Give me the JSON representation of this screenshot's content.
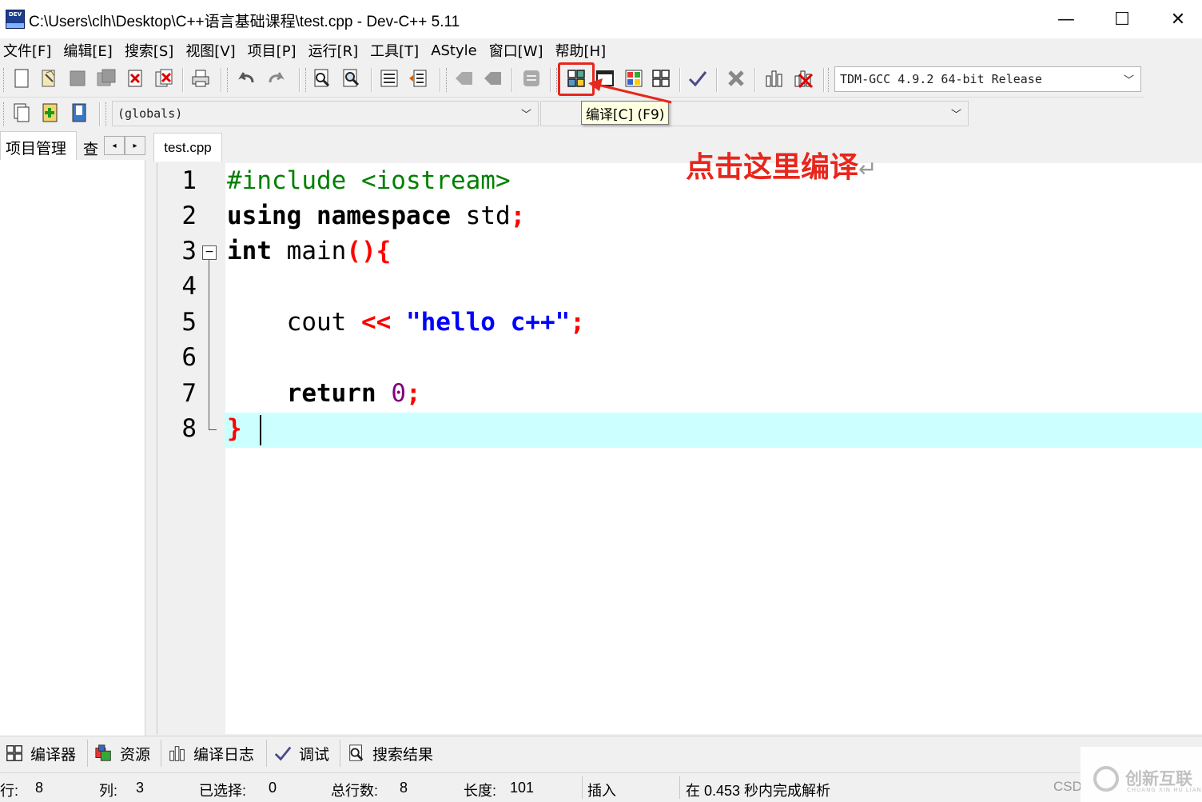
{
  "window": {
    "title": "C:\\Users\\clh\\Desktop\\C++语言基础课程\\test.cpp - Dev-C++ 5.11",
    "app_icon_text": "DEV",
    "minimize": "—",
    "maximize": "☐",
    "close": "✕"
  },
  "menu": [
    {
      "label": "文件[F]"
    },
    {
      "label": "编辑[E]"
    },
    {
      "label": "搜索[S]"
    },
    {
      "label": "视图[V]"
    },
    {
      "label": "项目[P]"
    },
    {
      "label": "运行[R]"
    },
    {
      "label": "工具[T]"
    },
    {
      "label": "AStyle"
    },
    {
      "label": "窗口[W]"
    },
    {
      "label": "帮助[H]"
    }
  ],
  "toolbar": {
    "compiler_select": "TDM-GCC 4.9.2 64-bit Release",
    "globals_select": "(globals)",
    "tooltip": "编译[C] (F9)",
    "highlight_color": "#e8261c"
  },
  "left_panel": {
    "tab_project": "项目管理",
    "tab_class": "查",
    "arrow_left": "◂",
    "arrow_right": "▸"
  },
  "editor": {
    "file_tab": "test.cpp",
    "line_numbers": [
      "1",
      "2",
      "3",
      "4",
      "5",
      "6",
      "7",
      "8"
    ],
    "fold_symbol": "−",
    "lines": {
      "l1_pre": "#include <iostream>",
      "l2_kw1": "using",
      "l2_kw2": "namespace",
      "l2_id": "std",
      "l2_semi": ";",
      "l3_kw": "int",
      "l3_id": "main",
      "l3_sym": "(){",
      "l5_id": "cout",
      "l5_op": "<<",
      "l5_str": "\"hello c++\"",
      "l5_semi": ";",
      "l7_kw": "return",
      "l7_num": "0",
      "l7_semi": ";",
      "l8_sym": "}"
    },
    "current_line_color": "#ccffff"
  },
  "annotation": {
    "text": "点击这里编译",
    "return_mark": "↵"
  },
  "bottom_tabs": [
    {
      "label": "编译器"
    },
    {
      "label": "资源"
    },
    {
      "label": "编译日志"
    },
    {
      "label": "调试"
    },
    {
      "label": "搜索结果"
    }
  ],
  "status": {
    "row_label": "行:",
    "row_value": "8",
    "col_label": "列:",
    "col_value": "3",
    "sel_label": "已选择:",
    "sel_value": "0",
    "total_label": "总行数:",
    "total_value": "8",
    "len_label": "长度:",
    "len_value": "101",
    "mode": "插入",
    "parse_msg": "在 0.453 秒内完成解析"
  },
  "watermark": {
    "csd": "CSD",
    "brand": "创新互联",
    "brand_sub": "CHUANG XIN HU LIAN"
  }
}
